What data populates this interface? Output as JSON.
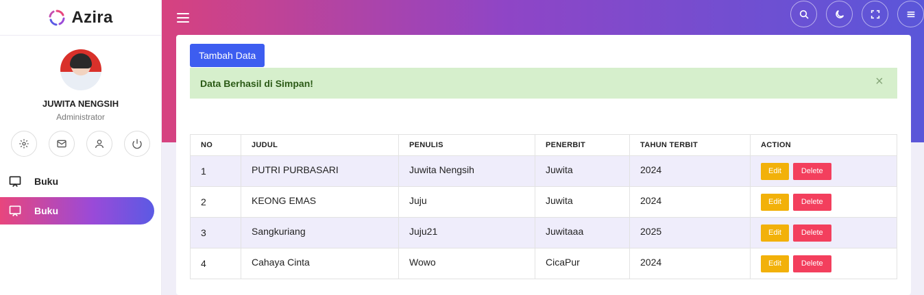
{
  "brand": {
    "name": "Azira"
  },
  "profile": {
    "name": "JUWITA NENGSIH",
    "role": "Administrator"
  },
  "profile_actions": [
    "settings-icon",
    "mail-icon",
    "user-icon",
    "power-icon"
  ],
  "sidebar": {
    "items": [
      {
        "label": "Buku",
        "icon": "monitor-icon",
        "active": false
      },
      {
        "label": "Buku",
        "icon": "monitor-icon",
        "active": true
      }
    ]
  },
  "topbar": {
    "icons": [
      "search-icon",
      "moon-icon",
      "fullscreen-icon",
      "menu-icon"
    ]
  },
  "main": {
    "add_label": "Tambah Data",
    "alert": {
      "message": "Data Berhasil di Simpan!",
      "close": "×"
    },
    "table": {
      "headers": [
        "NO",
        "JUDUL",
        "PENULIS",
        "PENERBIT",
        "TAHUN TERBIT",
        "ACTION"
      ],
      "rows": [
        {
          "no": "1",
          "judul": "PUTRI PURBASARI",
          "penulis": "Juwita Nengsih",
          "penerbit": "Juwita",
          "tahun": "2024"
        },
        {
          "no": "2",
          "judul": "KEONG EMAS",
          "penulis": "Juju",
          "penerbit": "Juwita",
          "tahun": "2024"
        },
        {
          "no": "3",
          "judul": "Sangkuriang",
          "penulis": "Juju21",
          "penerbit": "Juwitaaa",
          "tahun": "2025"
        },
        {
          "no": "4",
          "judul": "Cahaya Cinta",
          "penulis": "Wowo",
          "penerbit": "CicaPur",
          "tahun": "2024"
        }
      ],
      "edit_label": "Edit",
      "delete_label": "Delete"
    }
  },
  "colors": {
    "primary": "#3d5df0",
    "edit": "#f2b10a",
    "delete": "#f33f5d",
    "success_bg": "#d6efcc",
    "gradient_start": "#d7427f",
    "gradient_end": "#5a56d9"
  }
}
